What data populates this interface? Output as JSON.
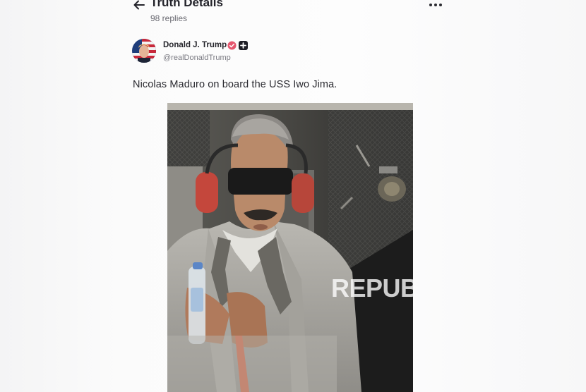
{
  "header": {
    "back_icon": "arrow-left-icon",
    "title": "Truth Details",
    "replies": "98 replies",
    "more_icon": "more-horizontal-icon"
  },
  "post": {
    "author_name": "Donald J. Trump",
    "author_handle": "@realDonaldTrump",
    "verified_icon": "verified-badge-icon",
    "plus_icon": "plus-badge-icon",
    "text": "Nicolas Maduro on board the USS Iwo Jima.",
    "image_watermark": "REPUB"
  },
  "colors": {
    "verified": "#e5566e",
    "text": "#1d1d22",
    "muted": "#6a6a72"
  }
}
